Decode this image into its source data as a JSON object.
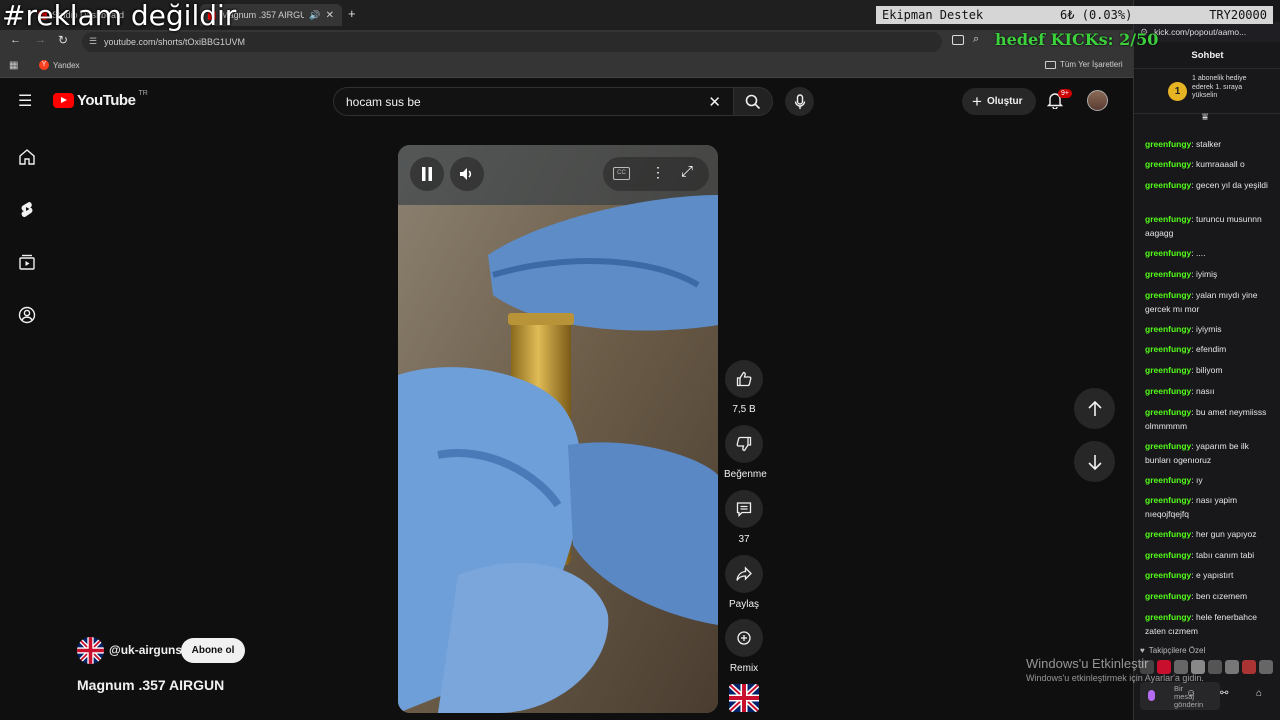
{
  "browser": {
    "tabs": [
      {
        "title": "Studio Dashboard"
      },
      {
        "title": "Magnum .357 AIRGUN"
      }
    ],
    "url": "youtube.com/shorts/tOxiBBG1UVM",
    "bookmark_yandex": "Yandex",
    "bookmark_all": "Tüm Yer İşaretleri"
  },
  "youtube": {
    "logo": "YouTube",
    "region": "TR",
    "search_value": "hocam sus be",
    "create_label": "Oluştur",
    "notif_badge": "9+",
    "channel": "@uk-airguns",
    "subscribe": "Abone ol",
    "video_title": "Magnum .357 AIRGUN",
    "likes": "7,5 B",
    "dislike_label": "Beğenme",
    "comments": "37",
    "share_label": "Paylaş",
    "remix_label": "Remix",
    "cc_label": "CC"
  },
  "chat": {
    "popout_url": "kick.com/popout/aamo...",
    "title": "Sohbet",
    "sub_rank": "1",
    "sub_text": "1 abonelik hediye ederek 1. sıraya yükselin",
    "messages": [
      {
        "user": "greenfungy",
        "text": "stalker"
      },
      {
        "user": "greenfungy",
        "text": "kumraaaall o"
      },
      {
        "user": "greenfungy",
        "text": "gecen yıl da yeşildi"
      },
      {
        "user": "greenfungy",
        "text": "turuncu musunnn aagagg"
      },
      {
        "user": "greenfungy",
        "text": "...."
      },
      {
        "user": "greenfungy",
        "text": "iyimiş"
      },
      {
        "user": "greenfungy",
        "text": "yalan mıydı yine gercek mı mor"
      },
      {
        "user": "greenfungy",
        "text": "iyiymis"
      },
      {
        "user": "greenfungy",
        "text": "efendim"
      },
      {
        "user": "greenfungy",
        "text": "biliyom"
      },
      {
        "user": "greenfungy",
        "text": "nasıı"
      },
      {
        "user": "greenfungy",
        "text": "bu amet neymiisss olmmmmm"
      },
      {
        "user": "greenfungy",
        "text": "yaparım be ilk bunları ogenıoruz"
      },
      {
        "user": "greenfungy",
        "text": "ıy"
      },
      {
        "user": "greenfungy",
        "text": "nası yapim nıeqojfqejfq"
      },
      {
        "user": "greenfungy",
        "text": "her gun yapıyoz"
      },
      {
        "user": "greenfungy",
        "text": "tabıı canım tabi"
      },
      {
        "user": "greenfungy",
        "text": "e yapıstırt"
      },
      {
        "user": "greenfungy",
        "text": "ben cızemem"
      },
      {
        "user": "greenfungy",
        "text": "hele fenerbahce zaten cızmem"
      }
    ],
    "followers_only": "Takipçilere Özel",
    "send_placeholder": "Bir mesaj gönderin"
  },
  "overlay": {
    "caption": "#reklam değildir",
    "ticker_label": "Ekipman Destek",
    "ticker_value": "6₺ (0.03%)",
    "ticker_goal": "TRY20000",
    "goal_text": "hedef KICKs: 2/50"
  },
  "watermark": {
    "line1": "Windows'u Etkinleştir",
    "line2": "Windows'u etkinleştirmek için Ayarlar'a gidin."
  },
  "colors": {
    "kick_green": "#53fc18",
    "yt_red": "#ff0000",
    "notif_red": "#cc0000"
  }
}
